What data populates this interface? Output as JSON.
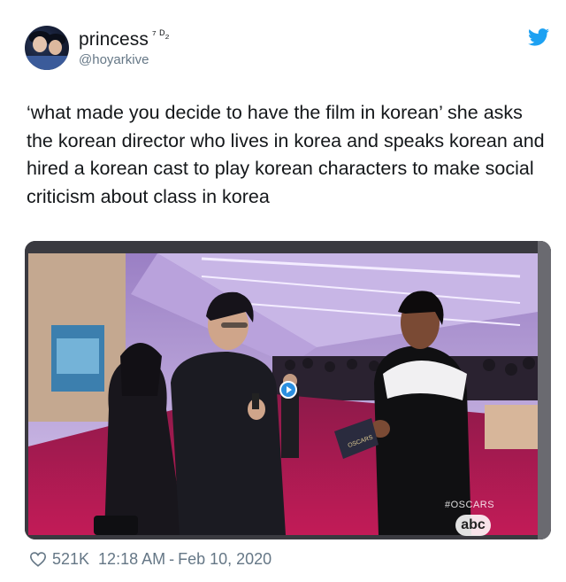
{
  "user": {
    "display_name": "princess",
    "display_suffix": "⁷ ᴰ₂",
    "handle": "@hoyarkive",
    "avatar": "avatar-photo"
  },
  "icons": {
    "platform": "twitter-bird-icon",
    "like": "heart-icon",
    "video_badge": "play-icon"
  },
  "colors": {
    "twitter_blue": "#1da1f2",
    "text": "#14171a",
    "muted": "#657786",
    "carpet": "#b8184f"
  },
  "tweet": {
    "text": "‘what made you decide to have the film in korean’ she asks the korean director who lives in korea and speaks korean and hired a korean cast to play korean characters to make social criticism about class in korea"
  },
  "media": {
    "overlay_tag": "#OSCARS",
    "network": "abc",
    "card_text": "OSCARS"
  },
  "footer": {
    "likes": "521K",
    "time": "12:18 AM",
    "separator": "-",
    "date": "Feb 10, 2020"
  }
}
